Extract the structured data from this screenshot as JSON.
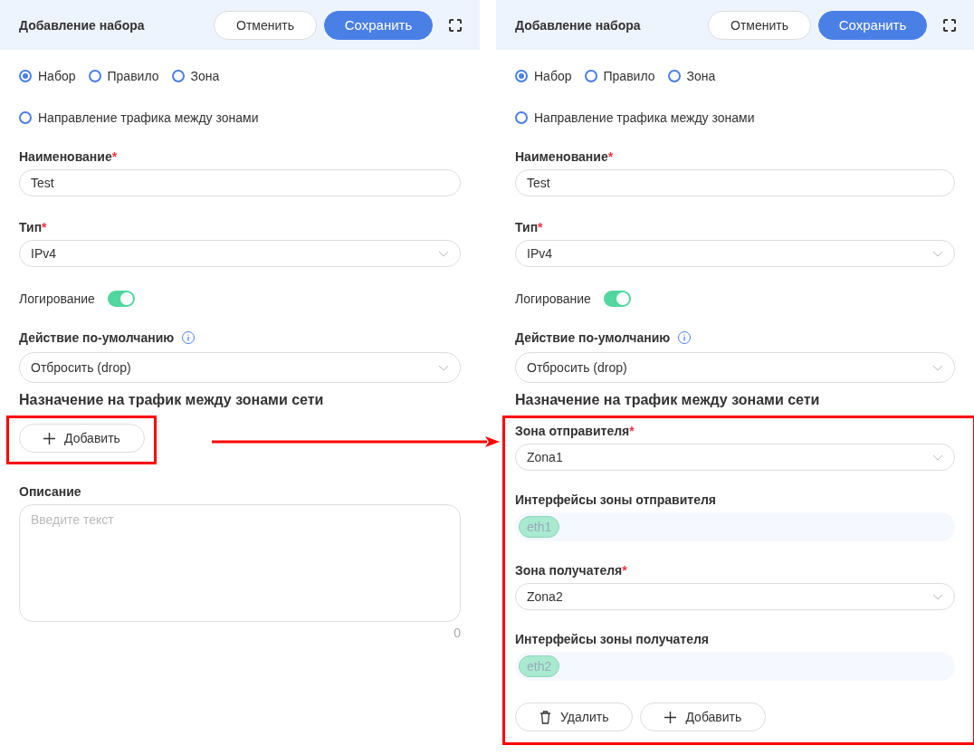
{
  "panels": [
    {
      "title": "Добавление набора",
      "cancel": "Отменить",
      "save": "Сохранить",
      "modes": [
        {
          "label": "Набор",
          "selected": true
        },
        {
          "label": "Правило",
          "selected": false
        },
        {
          "label": "Зона",
          "selected": false
        },
        {
          "label": "Направление трафика между зонами",
          "selected": false
        }
      ],
      "name": {
        "label": "Наименование",
        "required_mark": "*",
        "value": "Test"
      },
      "type": {
        "label": "Тип",
        "required_mark": "*",
        "value": "IPv4"
      },
      "logging": {
        "label": "Логирование",
        "on": true
      },
      "default_action": {
        "label": "Действие по-умолчанию",
        "value": "Отбросить (drop)"
      },
      "assignment": {
        "title": "Назначение на трафик между зонами сети",
        "highlighted": true,
        "buttons": [
          {
            "kind": "add",
            "label": "Добавить"
          }
        ]
      },
      "description": {
        "label": "Описание",
        "placeholder": "Введите текст",
        "count": "0"
      }
    },
    {
      "title": "Добавление набора",
      "cancel": "Отменить",
      "save": "Сохранить",
      "modes": [
        {
          "label": "Набор",
          "selected": true
        },
        {
          "label": "Правило",
          "selected": false
        },
        {
          "label": "Зона",
          "selected": false
        },
        {
          "label": "Направление трафика между зонами",
          "selected": false
        }
      ],
      "name": {
        "label": "Наименование",
        "required_mark": "*",
        "value": "Test"
      },
      "type": {
        "label": "Тип",
        "required_mark": "*",
        "value": "IPv4"
      },
      "logging": {
        "label": "Логирование",
        "on": true
      },
      "default_action": {
        "label": "Действие по-умолчанию",
        "value": "Отбросить (drop)"
      },
      "assignment": {
        "title": "Назначение на трафик между зонами сети",
        "highlighted": true,
        "fields": [
          {
            "kind": "select",
            "label": "Зона отправителя",
            "required_mark": "*",
            "value": "Zona1"
          },
          {
            "kind": "tags",
            "label": "Интерфейсы зоны отправителя",
            "tags": [
              "eth1"
            ]
          },
          {
            "kind": "select",
            "label": "Зона получателя",
            "required_mark": "*",
            "value": "Zona2"
          },
          {
            "kind": "tags",
            "label": "Интерфейсы зоны получателя",
            "tags": [
              "eth2"
            ]
          }
        ],
        "buttons": [
          {
            "kind": "delete",
            "label": "Удалить"
          },
          {
            "kind": "add",
            "label": "Добавить"
          }
        ]
      }
    }
  ]
}
